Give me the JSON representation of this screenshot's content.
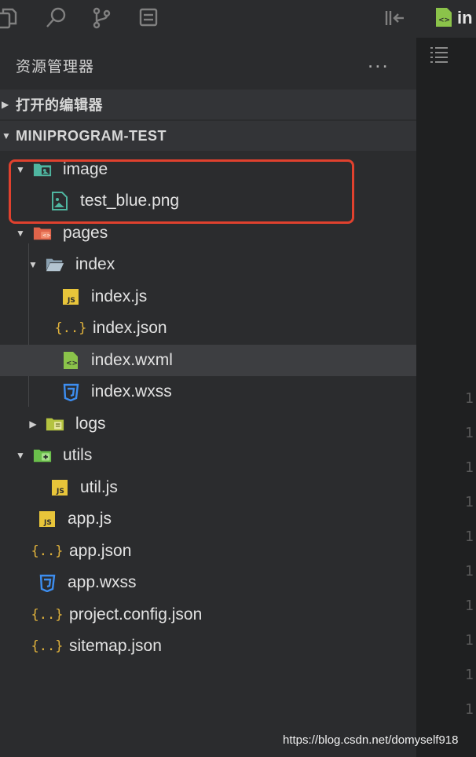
{
  "activity_bar": {
    "icons": [
      "files-icon",
      "search-icon",
      "source-control-icon",
      "debug-icon",
      "collapse-sidebar-icon"
    ]
  },
  "editor": {
    "tab_label": "in",
    "line_numbers": [
      "1(",
      "1",
      "1",
      "1",
      "1",
      "1",
      "1",
      "1",
      "1",
      "1"
    ]
  },
  "sidebar": {
    "header": "资源管理器",
    "more": "...",
    "open_editors_label": "打开的编辑器",
    "project_label": "MINIPROGRAM-TEST",
    "tree": [
      {
        "label": "image",
        "type": "folder-image",
        "expanded": true
      },
      {
        "label": "test_blue.png",
        "type": "image-file"
      },
      {
        "label": "pages",
        "type": "folder-pages",
        "expanded": true
      },
      {
        "label": "index",
        "type": "folder",
        "expanded": true
      },
      {
        "label": "index.js",
        "type": "js"
      },
      {
        "label": "index.json",
        "type": "json"
      },
      {
        "label": "index.wxml",
        "type": "wxml",
        "selected": true
      },
      {
        "label": "index.wxss",
        "type": "wxss"
      },
      {
        "label": "logs",
        "type": "folder-logs",
        "expanded": false
      },
      {
        "label": "utils",
        "type": "folder-utils",
        "expanded": true
      },
      {
        "label": "util.js",
        "type": "js"
      },
      {
        "label": "app.js",
        "type": "js"
      },
      {
        "label": "app.json",
        "type": "json"
      },
      {
        "label": "app.wxss",
        "type": "wxss"
      },
      {
        "label": "project.config.json",
        "type": "json"
      },
      {
        "label": "sitemap.json",
        "type": "json"
      }
    ]
  },
  "watermark": "https://blog.csdn.net/domyself918",
  "colors": {
    "background": "#2b2c2e",
    "selected_row": "#3d3e41",
    "highlight_border": "#e0412e",
    "js_icon": "#e8c53a",
    "json_icon": "#e0b23c",
    "wxml_icon": "#8bc34a",
    "wxss_icon": "#3d8ef0",
    "image_icon": "#4fb6a0",
    "pages_folder": "#e0644a"
  }
}
